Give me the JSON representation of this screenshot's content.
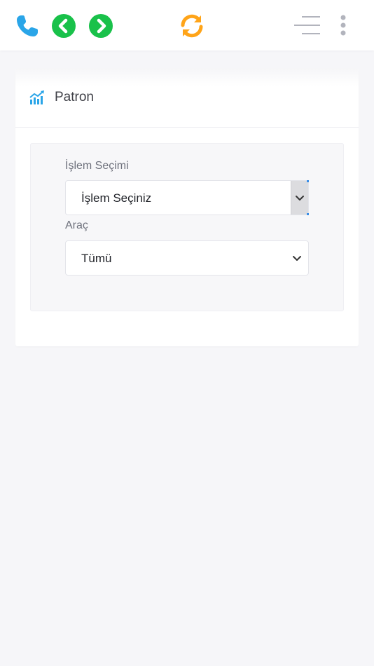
{
  "topbar": {
    "icons": {
      "phone": "phone-icon",
      "back": "chevron-left-circle-icon",
      "forward": "chevron-right-circle-icon",
      "refresh": "refresh-icon",
      "menu": "menu-icon",
      "more": "vertical-dots-icon"
    },
    "colors": {
      "phone": "#2aa5e8",
      "nav": "#19c14a",
      "refresh": "#ffa418",
      "menu": "#b2b4bd"
    }
  },
  "card": {
    "title": "Patron",
    "icon": "chart-icon",
    "icon_color": "#2aa5e8"
  },
  "form": {
    "islem_label": "İşlem Seçimi",
    "islem_value": "İşlem Seçiniz",
    "arac_label": "Araç",
    "arac_value": "Tümü"
  },
  "colors": {
    "background": "#f6f6f9",
    "card": "#ffffff",
    "panel": "#f7f7f9"
  }
}
